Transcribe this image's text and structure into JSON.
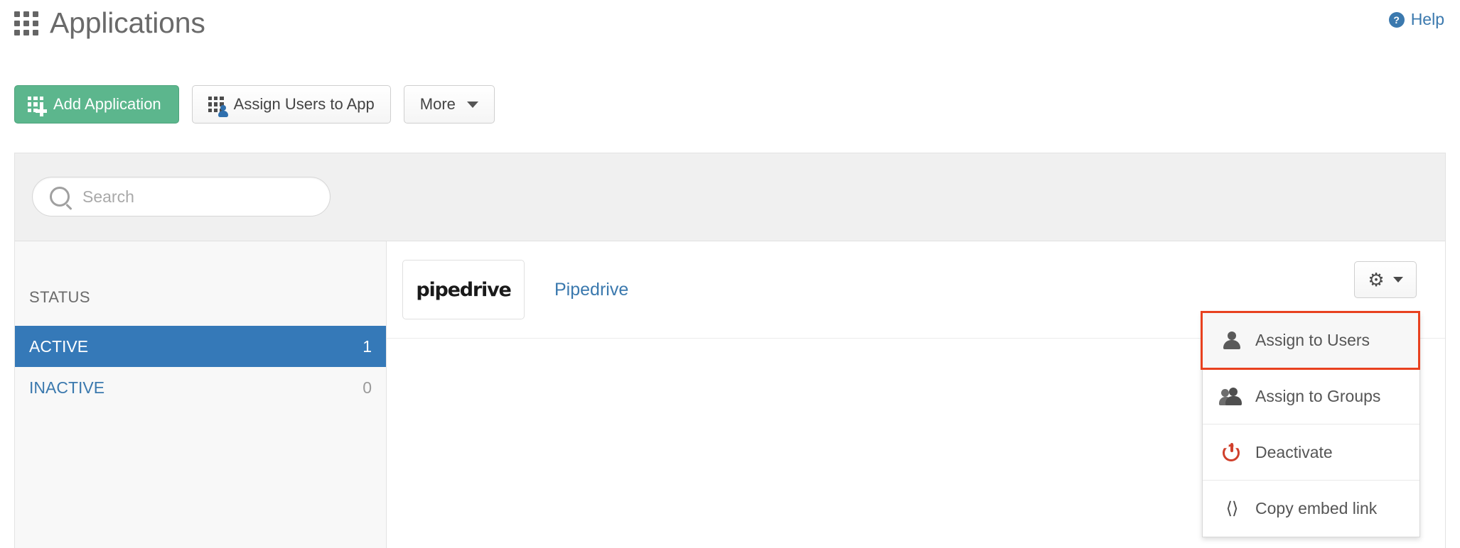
{
  "header": {
    "title": "Applications",
    "grid_icon": "grid-icon",
    "help": {
      "badge": "?",
      "label": "Help",
      "color": "#3b79ae"
    }
  },
  "toolbar": {
    "add_application_label": "Add Application",
    "add_application_icon": "grid-plus-icon",
    "add_application_color": "#5cb68d",
    "assign_users_label": "Assign Users to App",
    "assign_users_icon": "grid-person-icon",
    "more_label": "More",
    "more_icon": "chevron-down-icon"
  },
  "search": {
    "placeholder": "Search",
    "value": "",
    "icon": "search-icon"
  },
  "sidebar": {
    "heading": "STATUS",
    "filters": [
      {
        "label": "ACTIVE",
        "count": "1",
        "selected": true
      },
      {
        "label": "INACTIVE",
        "count": "0",
        "selected": false
      }
    ],
    "selected_color": "#3579b8"
  },
  "apps": [
    {
      "logo_text": "pipedrive",
      "name": "Pipedrive"
    }
  ],
  "gear_button": {
    "icon": "gear-icon",
    "caret": "chevron-down-icon"
  },
  "dropdown": {
    "items": [
      {
        "label": "Assign to Users",
        "icon": "person-icon",
        "highlighted": true
      },
      {
        "label": "Assign to Groups",
        "icon": "people-icon",
        "highlighted": false
      },
      {
        "label": "Deactivate",
        "icon": "power-icon",
        "highlighted": false
      },
      {
        "label": "Copy embed link",
        "icon": "code-brackets-icon",
        "highlighted": false
      }
    ],
    "highlight_color": "#e8411f"
  }
}
